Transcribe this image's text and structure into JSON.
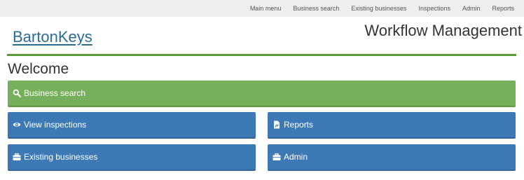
{
  "nav": {
    "items": [
      {
        "label": "Main menu"
      },
      {
        "label": "Business search"
      },
      {
        "label": "Existing businesses"
      },
      {
        "label": "Inspections"
      },
      {
        "label": "Admin"
      },
      {
        "label": "Reports"
      }
    ]
  },
  "header": {
    "brand": "BartonKeys",
    "title": "Workflow Management"
  },
  "main": {
    "heading": "Welcome",
    "tiles": {
      "business_search": {
        "label": "Business search",
        "icon": "search-icon"
      },
      "view_inspections": {
        "label": "View inspections",
        "icon": "eye-icon"
      },
      "reports": {
        "label": "Reports",
        "icon": "document-icon"
      },
      "existing_businesses": {
        "label": "Existing businesses",
        "icon": "briefcase-icon"
      },
      "admin": {
        "label": "Admin",
        "icon": "briefcase-icon"
      }
    }
  },
  "colors": {
    "nav_bg": "#eeeeee",
    "brand": "#2a6c96",
    "rule": "#5a9a3c",
    "tile_green": "#77b05b",
    "tile_blue": "#3d7ab5"
  }
}
